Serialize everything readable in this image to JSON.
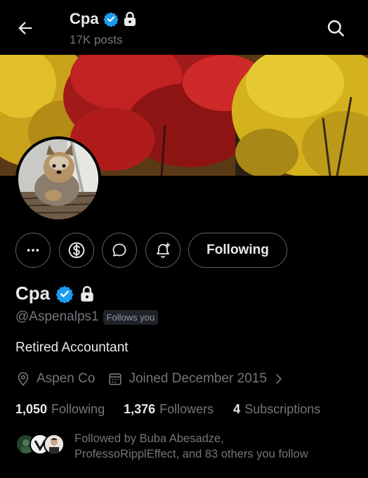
{
  "header": {
    "name": "Cpa",
    "posts_count": "17K posts"
  },
  "profile": {
    "name": "Cpa",
    "handle": "@Aspenalps1",
    "follows_you_badge": "Follows you",
    "bio": "Retired Accountant",
    "location": "Aspen Co",
    "joined": "Joined December 2015"
  },
  "actions": {
    "following_label": "Following"
  },
  "stats": {
    "following_count": "1,050",
    "following_label": "Following",
    "followers_count": "1,376",
    "followers_label": "Followers",
    "subscriptions_count": "4",
    "subscriptions_label": "Subscriptions"
  },
  "followed_by": {
    "line1": "Followed by Buba Abesadze,",
    "line2": "ProfessoRipplEffect, and 83 others you follow"
  },
  "colors": {
    "verified_blue": "#1d9bf0",
    "secondary_text": "#71767b",
    "border": "#536471"
  },
  "icons": [
    "back-arrow-icon",
    "verified-badge-icon",
    "lock-icon",
    "search-icon",
    "more-icon",
    "dollar-icon",
    "message-icon",
    "notification-bell-icon",
    "location-icon",
    "calendar-icon",
    "chevron-right-icon"
  ]
}
